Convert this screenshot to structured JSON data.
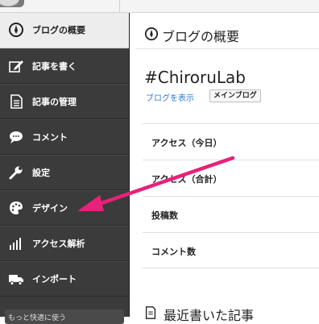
{
  "sidebar": {
    "items": [
      {
        "label": "ブログの概要",
        "icon": "dashboard-icon",
        "active": true
      },
      {
        "label": "記事を書く",
        "icon": "pencil-icon"
      },
      {
        "label": "記事の管理",
        "icon": "document-icon"
      },
      {
        "label": "コメント",
        "icon": "speech-bubble-icon"
      },
      {
        "label": "設定",
        "icon": "wrench-icon"
      },
      {
        "label": "デザイン",
        "icon": "palette-icon"
      },
      {
        "label": "アクセス解析",
        "icon": "bar-chart-icon"
      },
      {
        "label": "インポート",
        "icon": "truck-icon"
      }
    ],
    "bottom_label": "もっと快適に使う"
  },
  "main": {
    "page_title": "ブログの概要",
    "blog_name": "#ChiroruLab",
    "view_link": "ブログを表示",
    "main_badge": "メインブログ",
    "stats": [
      "アクセス（今日）",
      "アクセス（合計）",
      "投稿数",
      "コメント数"
    ],
    "recent_title": "最近書いた記事"
  },
  "colors": {
    "sidebar_bg": "#3b3b3b",
    "active_bg": "#ededed",
    "link": "#2a7ad2",
    "annotation_arrow": "#e8217a"
  }
}
